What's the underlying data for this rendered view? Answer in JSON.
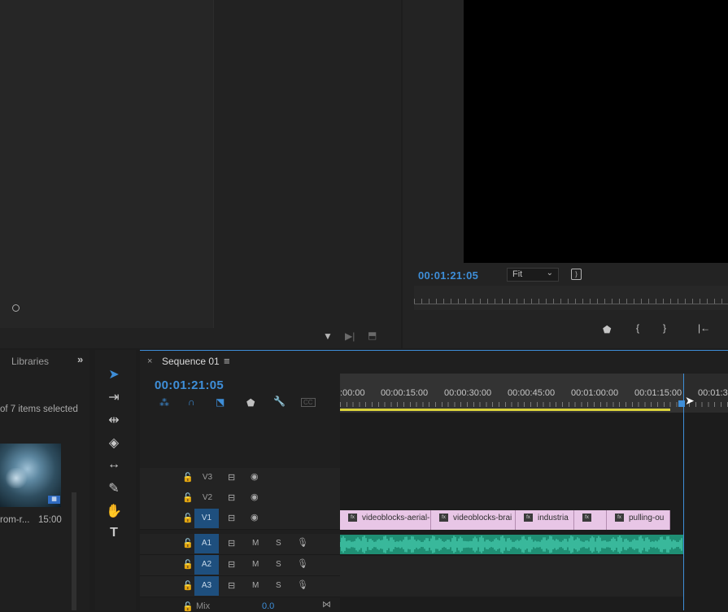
{
  "program": {
    "timecode": "00:01:21:05",
    "fit_value": "Fit"
  },
  "project": {
    "tab_label": "Libraries",
    "selection_status": "of 7 items selected",
    "clip_name": "rom-r...",
    "clip_duration": "15:00"
  },
  "timeline": {
    "sequence_title": "Sequence 01",
    "timecode": "00:01:21:05",
    "ruler_labels": [
      ":00:00",
      "00:00:15:00",
      "00:00:30:00",
      "00:00:45:00",
      "00:01:00:00",
      "00:01:15:00",
      "00:01:3"
    ],
    "cc_label": "CC",
    "video_tracks": [
      {
        "name": "V3"
      },
      {
        "name": "V2"
      },
      {
        "name": "V1"
      }
    ],
    "audio_tracks": [
      {
        "name": "A1",
        "m": "M",
        "s": "S"
      },
      {
        "name": "A2",
        "m": "M",
        "s": "S"
      },
      {
        "name": "A3",
        "m": "M",
        "s": "S"
      }
    ],
    "source_patch": "A1",
    "mix_label": "Mix",
    "mix_value": "0.0",
    "v1_clips": [
      "videoblocks-aerial-",
      "videoblocks-brai",
      "industria",
      "",
      "pulling-ou"
    ],
    "fx_label": "fx"
  },
  "colors": {
    "accent": "#3e8ed8",
    "video_clip": "#e8c6e6",
    "audio_clip": "#1f8f74",
    "work_area": "#d9d23b"
  }
}
